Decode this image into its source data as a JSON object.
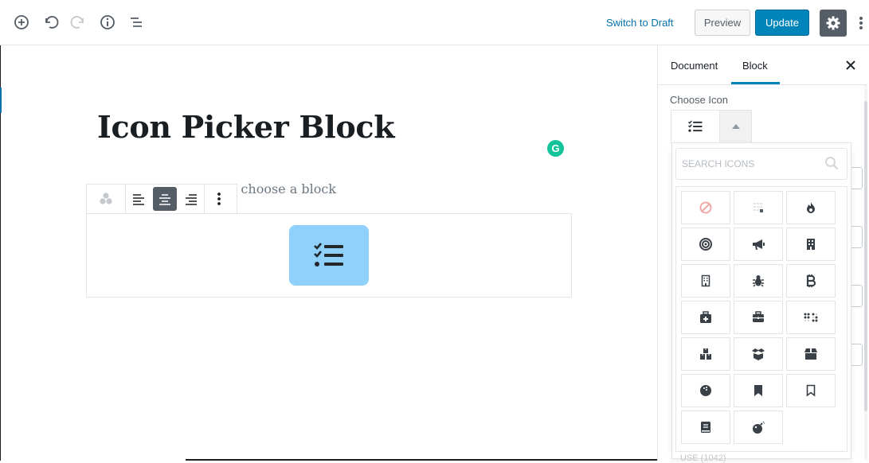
{
  "topbar": {
    "switch_to_draft": "Switch to Draft",
    "preview": "Preview",
    "update": "Update",
    "icons": [
      "add-block-icon",
      "undo-icon",
      "redo-icon",
      "info-icon",
      "outline-list-icon",
      "gear-icon",
      "more-vertical-icon"
    ]
  },
  "editor": {
    "title": "Icon Picker Block",
    "placeholder_visible": "o choose a block",
    "grammarly_badge": "G"
  },
  "sidebar": {
    "tabs": [
      "Document",
      "Block"
    ],
    "active_tab": "Block",
    "choose_icon_label": "Choose Icon",
    "search_placeholder": "SEARCH ICONS",
    "footer_partial": "USE (1042)",
    "icons": [
      "ban",
      "table",
      "fire",
      "bullseye",
      "bullhorn",
      "building",
      "building-outline",
      "bug",
      "bitcoin",
      "medkit",
      "briefcase",
      "braille",
      "boxes",
      "box-open",
      "box",
      "bowling-ball",
      "bookmark",
      "bookmark-outline",
      "book",
      "bomb"
    ]
  },
  "colors": {
    "accent": "#0085ba",
    "link": "#0073aa",
    "tile": "#8fd1fb",
    "dark": "#555d66",
    "grammarly": "#15c39a"
  }
}
